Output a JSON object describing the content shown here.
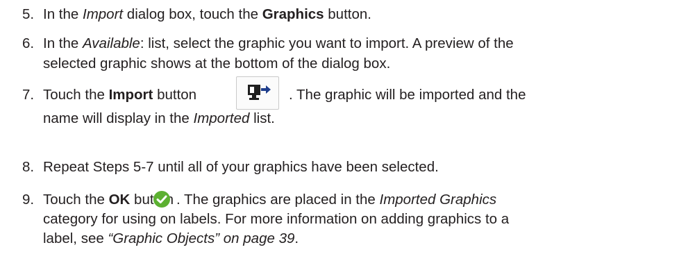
{
  "steps": [
    {
      "number": "5.",
      "l1_a": "In the ",
      "l1_b": "Import",
      "l1_c": " dialog box, touch the ",
      "l1_d": "Graphics",
      "l1_e": " button."
    },
    {
      "number": "6.",
      "l1_a": "In the ",
      "l1_b": "Available",
      "l1_c": ": list, select the graphic you want to import. A preview of the",
      "l2": "selected graphic shows at the bottom of the dialog box."
    },
    {
      "number": "7.",
      "l1_a": "Touch the ",
      "l1_b": "Import",
      "l1_c": " button",
      "l1_d": ". The graphic will be imported and the",
      "l2_a": "name will display in the ",
      "l2_b": "Imported",
      "l2_c": " list.",
      "icon": "import-graphic-icon"
    },
    {
      "number": "8.",
      "l1": "Repeat Steps 5-7 until all of your graphics have been selected."
    },
    {
      "number": "9.",
      "l1_a": "Touch the ",
      "l1_b": "OK",
      "l1_c": " button",
      "l1_d": ". The graphics are placed in the ",
      "l1_e": "Imported Graphics",
      "l2": "category for using on labels. For more information on adding graphics to a",
      "l3_a": "label, see ",
      "l3_b": "“Graphic Objects” on page 39",
      "l3_c": ".",
      "icon": "ok-check-icon",
      "icon_color": "#5cb031"
    }
  ]
}
